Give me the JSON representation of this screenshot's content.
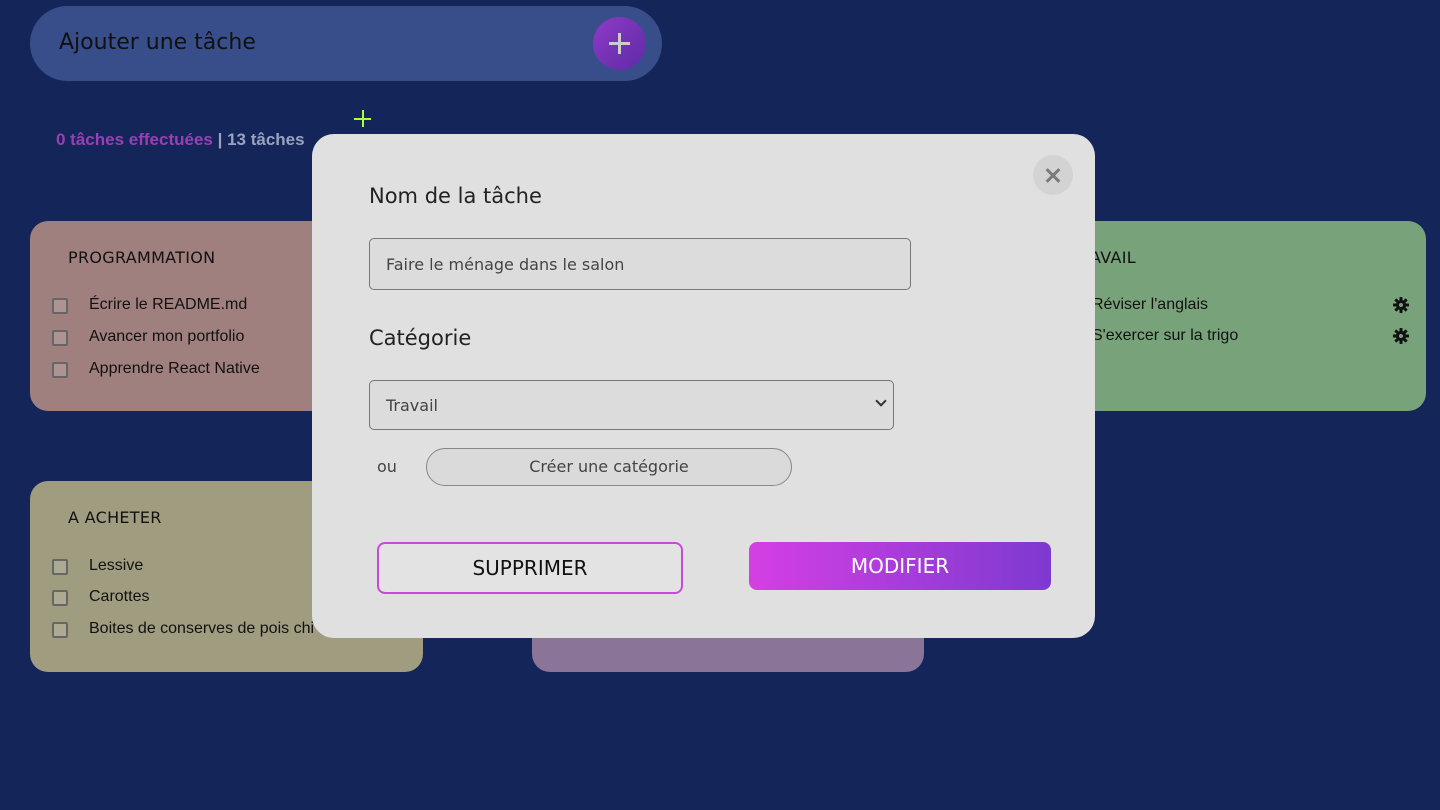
{
  "add_bar": {
    "label": "Ajouter une tâche"
  },
  "stats": {
    "done": "0 tâches effectuées",
    "total": " | 13 tâches"
  },
  "cards": {
    "programmation": {
      "title": "PROGRAMMATION",
      "color": "#a0807f",
      "items": [
        "Écrire le README.md",
        "Avancer mon portfolio",
        "Apprendre React Native"
      ]
    },
    "acheter": {
      "title": "A ACHETER",
      "color": "#9f9c80",
      "items": [
        "Lessive",
        "Carottes",
        "Boites de conserves de pois chi"
      ]
    },
    "travail": {
      "title": "AVAIL",
      "color": "#78a27a",
      "items": [
        "Réviser l'anglais",
        "S'exercer sur la trigo"
      ]
    },
    "purple": {
      "color": "#8a7598"
    }
  },
  "modal": {
    "name_label": "Nom de la tâche",
    "name_value": "Faire le ménage dans le salon",
    "category_label": "Catégorie",
    "category_selected": "Travail",
    "or_label": "ou",
    "create_category": "Créer une catégorie",
    "delete_label": "SUPPRIMER",
    "modify_label": "MODIFIER"
  },
  "colors": {
    "background": "#14255a",
    "accent": "#c94ad9",
    "add_bar": "#384e8a",
    "plus_highlight": "#a8ff3a"
  }
}
